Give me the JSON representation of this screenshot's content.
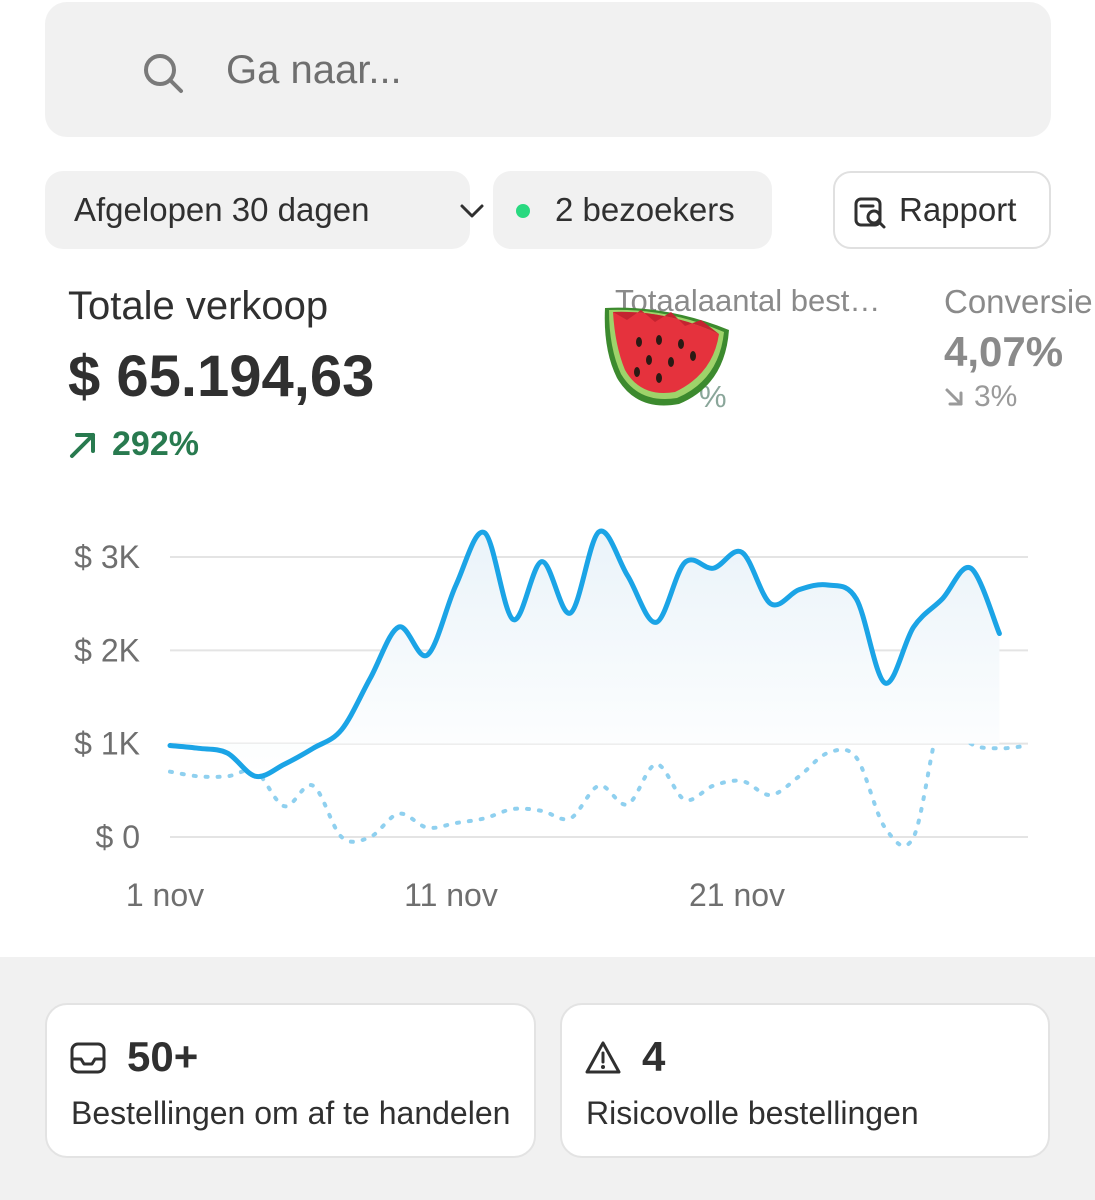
{
  "search": {
    "placeholder": "Ga naar..."
  },
  "filters": {
    "range_label": "Afgelopen 30 dagen",
    "visitors_label": "2 bezoekers",
    "report_label": "Rapport",
    "live_dot_color": "#29d980"
  },
  "metrics": {
    "total_sales": {
      "title": "Totale verkoop",
      "value": "$ 65.194,63",
      "change": "292%",
      "direction": "up",
      "color": "#287a4f"
    },
    "total_orders": {
      "title": "Totaalaantal bestellingen",
      "change_visible": "%",
      "overlay_icon": "watermelon-emoji"
    },
    "conversion": {
      "title": "Conversie",
      "value": "4,07%",
      "change": "3%",
      "direction": "down"
    }
  },
  "chart_data": {
    "type": "line",
    "y_ticks": [
      "$ 0",
      "$ 1K",
      "$ 2K",
      "$ 3K"
    ],
    "x_ticks": [
      "1 nov",
      "11 nov",
      "21 nov"
    ],
    "ylim": [
      0,
      3000
    ],
    "grid": true,
    "x": [
      1,
      2,
      3,
      4,
      5,
      6,
      7,
      8,
      9,
      10,
      11,
      12,
      13,
      14,
      15,
      16,
      17,
      18,
      19,
      20,
      21,
      22,
      23,
      24,
      25,
      26,
      27,
      28,
      29,
      30,
      31
    ],
    "series": [
      {
        "style": "solid",
        "color": "#1ba4e6",
        "values": [
          980,
          950,
          900,
          650,
          780,
          950,
          1150,
          1700,
          2250,
          1950,
          2700,
          3260,
          2330,
          2950,
          2400,
          3270,
          2800,
          2300,
          2940,
          2880,
          3050,
          2500,
          2650,
          2700,
          2550,
          1650,
          2250,
          2550,
          2880,
          2180,
          null
        ],
        "data": "current"
      },
      {
        "style": "dotted",
        "color": "#8fd0ef",
        "values": [
          700,
          650,
          650,
          700,
          330,
          550,
          0,
          0,
          250,
          100,
          150,
          200,
          300,
          280,
          200,
          550,
          350,
          780,
          400,
          550,
          600,
          450,
          650,
          900,
          850,
          100,
          0,
          1300,
          1000,
          950,
          980
        ],
        "data": "previous"
      }
    ]
  },
  "cards": [
    {
      "icon": "inbox-icon",
      "count": "50+",
      "label": "Bestellingen om af te handelen"
    },
    {
      "icon": "warning-icon",
      "count": "4",
      "label": "Risicovolle bestellingen"
    }
  ]
}
